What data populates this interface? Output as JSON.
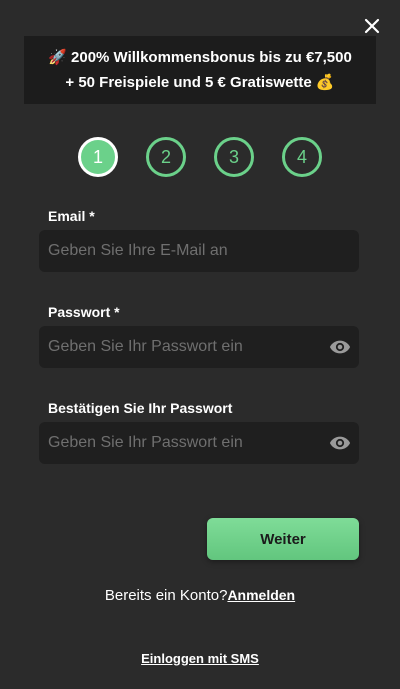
{
  "close": {
    "icon": "close-icon"
  },
  "promo": {
    "line1_emoji": "🚀",
    "line1_text": " 200% Willkommensbonus bis zu €7,500",
    "line2_text": "+ 50 Freispiele und 5 € Gratiswette ",
    "line2_emoji": "💰"
  },
  "steps": [
    {
      "label": "1",
      "state": "active"
    },
    {
      "label": "2",
      "state": "inactive"
    },
    {
      "label": "3",
      "state": "inactive"
    },
    {
      "label": "4",
      "state": "inactive"
    }
  ],
  "form": {
    "email_label": "Email *",
    "email_placeholder": "Geben Sie Ihre E-Mail an",
    "password_label": "Passwort *",
    "password_placeholder": "Geben Sie Ihr Passwort ein",
    "confirm_label": "Bestätigen Sie Ihr Passwort",
    "confirm_placeholder": "Geben Sie Ihr Passwort ein",
    "toggle_icon": "eye-icon"
  },
  "actions": {
    "next_label": "Weiter",
    "have_account_text": "Bereits ein Konto?",
    "login_label": "Anmelden",
    "sms_label": "Einloggen mit SMS"
  },
  "colors": {
    "background": "#2b2b2b",
    "accent": "#6bd18a",
    "field_bg": "#1f1f1f",
    "promo_bg": "#1c1c1c"
  }
}
